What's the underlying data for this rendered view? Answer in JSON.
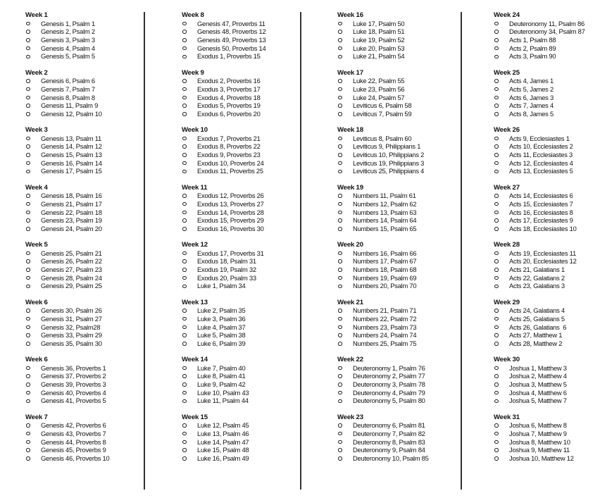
{
  "columns": [
    {
      "weeks": [
        {
          "title": "Week 1",
          "items": [
            "Genesis 1, Psalm 1",
            "Genesis 2, Psalm 2",
            "Genesis 3, Psalm 3",
            "Genesis 4, Psalm 4",
            "Genesis 5, Psalm 5"
          ]
        },
        {
          "title": "Week 2",
          "items": [
            "Genesis 6, Psalm 6",
            "Genesis 7, Psalm 7",
            "Genesis 8, Psalm 8",
            "Genesis 11, Psalm 9",
            "Genesis 12, Psalm 10"
          ]
        },
        {
          "title": "Week 3",
          "items": [
            "Genesis 13, Psalm 11",
            "Genesis 14, Psalm 12",
            "Genesis 15, Psalm 13",
            "Genesis 16, Psalm 14",
            "Genesis 17, Psalm 15"
          ]
        },
        {
          "title": "Week 4",
          "items": [
            "Genesis 18, Psalm 16",
            "Genesis 21, Psalm 17",
            "Genesis 22, Psalm 18",
            "Genesis 23, Psalm 19",
            "Genesis 24, Psalm 20"
          ]
        },
        {
          "title": "Week 5",
          "items": [
            "Genesis 25, Psalm 21",
            "Genesis 26, Psalm 22",
            "Genesis 27, Psalm 23",
            "Genesis 28, Psalm 24",
            "Genesis 29, Psalm 25"
          ]
        },
        {
          "title": "Week 6",
          "items": [
            "Genesis 30, Psalm 26",
            "Genesis 31, Psalm 27",
            "Genesis 32, Psalm28",
            "Genesis 33, Psalm 29",
            "Genesis 35, Psalm 30"
          ]
        },
        {
          "title": "Week 6",
          "items": [
            "Genesis 36, Proverbs 1",
            "Genesis 37, Proverbs 2",
            "Genesis 39, Proverbs 3",
            "Genesis 40, Proverbs 4",
            "Genesis 41, Proverbs 5"
          ]
        },
        {
          "title": "Week 7",
          "items": [
            "Genesis 42, Proverbs 6",
            "Genesis 43, Proverbs 7",
            "Genesis 44, Proverbs 8",
            "Genesis 45, Proverbs 9",
            "Genesis 46, Proverbs 10"
          ]
        }
      ]
    },
    {
      "weeks": [
        {
          "title": "Week 8",
          "items": [
            "Genesis 47, Proverbs 11",
            "Genesis 48, Proverbs 12",
            "Genesis 49, Proverbs 13",
            "Genesis 50, Proverbs 14",
            "Exodus 1, Proverbs 15"
          ]
        },
        {
          "title": "Week 9",
          "items": [
            "Exodus 2, Proverbs 16",
            "Exodus 3, Proverbs 17",
            "Exodus 4, Proverbs 18",
            "Exodus 5, Proverbs 19",
            "Exodus 6, Proverbs 20"
          ]
        },
        {
          "title": "Week 10",
          "items": [
            "Exodus 7, Proverbs 21",
            "Exodus 8, Proverbs 22",
            "Exodus 9, Proverbs 23",
            "Exodus 10, Proverbs 24",
            "Exodus 11, Proverbs 25"
          ]
        },
        {
          "title": "Week 11",
          "items": [
            "Exodus 12, Proverbs 26",
            "Exodus 13, Proverbs 27",
            "Exodus 14, Proverbs 28",
            "Exodus 15, Proverbs 29",
            "Exodus 16, Proverbs 30"
          ]
        },
        {
          "title": "Week 12",
          "items": [
            "Exodus 17, Proverbs 31",
            "Exodus 18, Psalm 31",
            "Exodus 19, Psalm 32",
            "Exodus 20, Psalm 33",
            "Luke 1, Psalm 34"
          ]
        },
        {
          "title": "Week 13",
          "items": [
            "Luke 2, Psalm 35",
            "Luke 3, Psalm 36",
            "Luke 4, Psalm 37",
            "Luke 5, Psalm 38",
            "Luke 6, Psalm 39"
          ]
        },
        {
          "title": "Week 14",
          "items": [
            "Luke 7, Psalm 40",
            "Luke 8, Psalm 41",
            "Luke 9, Psalm 42",
            "Luke 10, Psalm 43",
            "Luke 11, Psalm 44"
          ]
        },
        {
          "title": "Week 15",
          "items": [
            "Luke 12, Psalm 45",
            "Luke 13, Psalm 46",
            "Luke 14, Psalm 47",
            "Luke 15, Psalm 48",
            "Luke 16, Psalm 49"
          ]
        }
      ]
    },
    {
      "weeks": [
        {
          "title": "Week 16",
          "items": [
            "Luke 17, Psalm 50",
            "Luke 18, Psalm 51",
            "Luke 19, Psalm 52",
            "Luke 20, Psalm 53",
            "Luke 21, Psalm 54"
          ]
        },
        {
          "title": "Week 17",
          "items": [
            "Luke 22, Psalm 55",
            "Luke 23, Psalm 56",
            "Luke 24, Psalm 57",
            "Leviticus 6, Psalm 58",
            "Leviticus 7, Psalm 59"
          ]
        },
        {
          "title": "Week 18",
          "items": [
            "Leviticus 8, Psalm 60",
            "Leviticus 9, Philippians 1",
            "Leviticus 10, Philippians 2",
            "Leviticus 19, Philippians 3",
            "Leviticus 25, Philippians 4"
          ]
        },
        {
          "title": "Week 19",
          "items": [
            "Numbers 11, Psalm 61",
            "Numbers 12, Psalm 62",
            "Numbers 13, Psalm 63",
            "Numbers 14, Psalm 64",
            "Numbers 15, Psalm 65"
          ]
        },
        {
          "title": "Week 20",
          "items": [
            "Numbers 16, Psalm 66",
            "Numbers 17, Psalm 67",
            "Numbers 18, Psalm 68",
            "Numbers 19, Psalm 69",
            "Numbers 20, Psalm 70"
          ]
        },
        {
          "title": "Week 21",
          "items": [
            "Numbers 21, Psalm 71",
            "Numbers 22, Psalm 72",
            "Numbers 23, Psalm 73",
            "Numbers 24, Psalm 74",
            "Numbers 25, Psalm 75"
          ]
        },
        {
          "title": "Week 22",
          "items": [
            "Deuteronomy 1, Psalm 76",
            "Deuteronomy 2, Psalm 77",
            "Deuteronomy 3, Psalm 78",
            "Deuteronomy 4, Psalm 79",
            "Deuteronomy 5, Psalm 80"
          ]
        },
        {
          "title": "Week 23",
          "items": [
            "Deuteronomy 6, Psalm 81",
            "Deuteronomy 7, Psalm 82",
            "Deuteronomy 8, Psalm 83",
            "Deuteronomy 9, Psalm 84",
            "Deuteronomy 10, Psalm 85"
          ]
        }
      ]
    },
    {
      "weeks": [
        {
          "title": "Week 24",
          "items": [
            "Deuteronomy 11, Psalm 86",
            "Deuteronomy 34, Psalm 87",
            "Acts 1, Psalm 88",
            "Acts 2, Psalm 89",
            "Acts 3, Psalm 90"
          ]
        },
        {
          "title": "Week 25",
          "items": [
            "Acts 4, James 1",
            "Acts 5, James 2",
            "Acts 6, James 3",
            "Acts 7, James 4",
            "Acts 8, James 5"
          ]
        },
        {
          "title": "Week 26",
          "items": [
            "Acts 9, Ecclesiastes 1",
            "Acts 10, Ecclesiastes 2",
            "Acts 11, Ecclesiastes 3",
            "Acts 12, Ecclesiastes 4",
            "Acts 13, Ecclesiastes 5"
          ]
        },
        {
          "title": "Week 27",
          "items": [
            "Acts 14, Ecclesiastes 6",
            "Acts 15, Ecclesiastes 7",
            "Acts 16, Ecclesiastes 8",
            "Acts 17, Ecclesiastes 9",
            "Acts 18, Ecclesiastes 10"
          ]
        },
        {
          "title": "Week 28",
          "items": [
            "Acts 19, Ecclesiastes 11",
            "Acts 20, Ecclesiastes 12",
            "Acts 21, Galatians 1",
            "Acts 22, Galatians 2",
            "Acts 23, Galatians 3"
          ]
        },
        {
          "title": "Week 29",
          "items": [
            "Acts 24, Galatians 4",
            "Acts 25, Galatians 5",
            "Acts 26, Galatians  6",
            "Acts 27, Matthew 1",
            "Acts 28, Matthew 2"
          ]
        },
        {
          "title": "Week 30",
          "items": [
            "Joshua 1, Matthew 3",
            "Joshua 2, Matthew 4",
            "Joshua 3, Matthew 5",
            "Joshua 4, Matthew 6",
            "Joshua 5, Matthew 7"
          ]
        },
        {
          "title": "Week 31",
          "items": [
            "Joshua 6, Matthew 8",
            "Joshua 7, Matthew 9",
            "Joshua 8, Matthew 10",
            "Joshua 9, Matthew 11",
            "Joshua 10, Matthew 12"
          ]
        }
      ]
    }
  ],
  "bullet_icon": "hollow-circle-bullet"
}
